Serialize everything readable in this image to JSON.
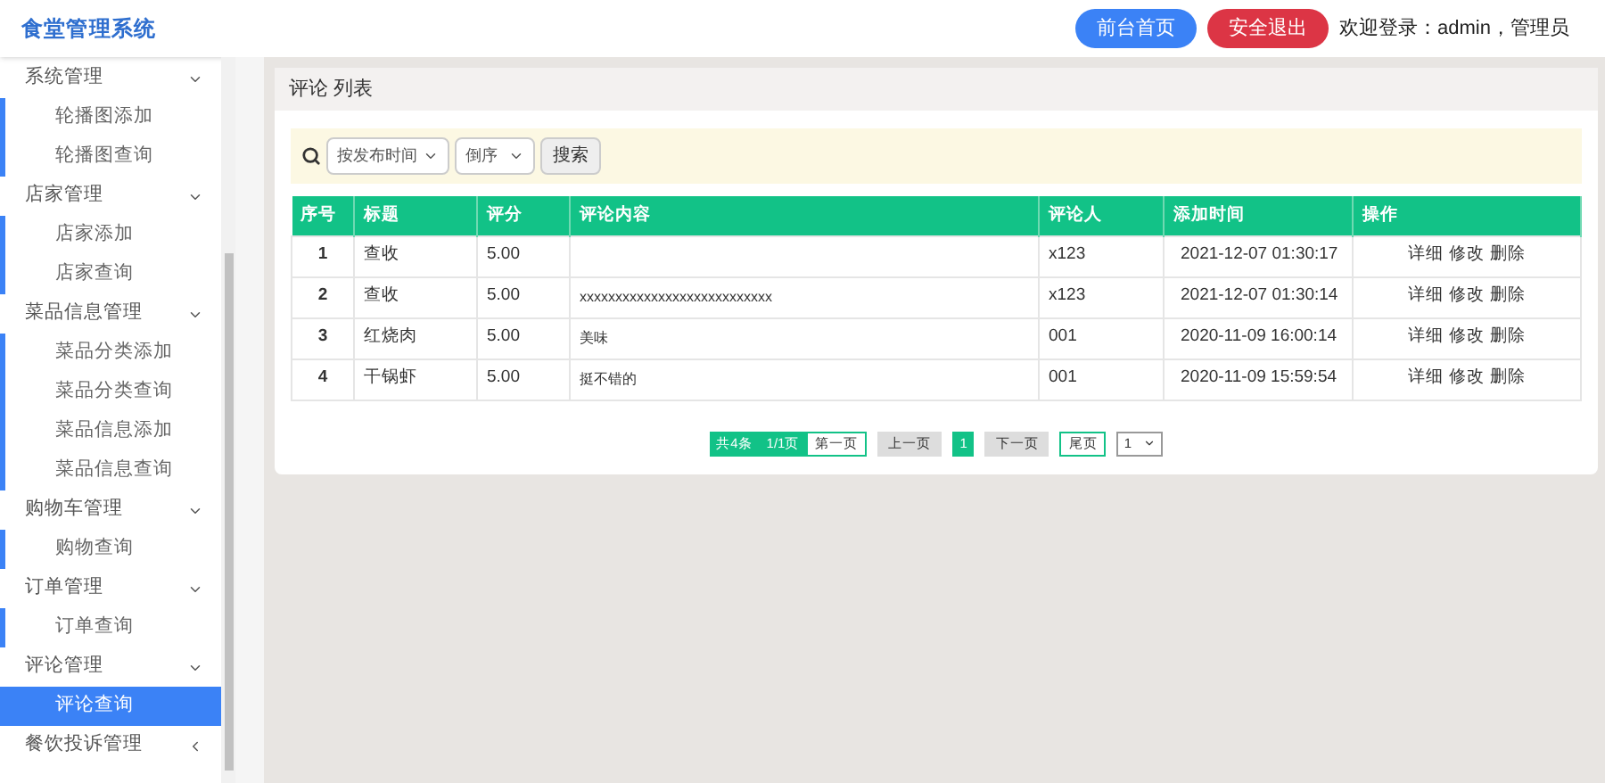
{
  "header": {
    "title": "食堂管理系统",
    "buttons": [
      {
        "label": "前台首页",
        "kind": "primary"
      },
      {
        "label": "安全退出",
        "kind": "danger"
      }
    ],
    "welcome": "欢迎登录：admin，管理员"
  },
  "sidebar": {
    "groups": [
      {
        "label": "系统管理",
        "expanded": true,
        "children": [
          {
            "label": "轮播图添加",
            "selected": false
          },
          {
            "label": "轮播图查询",
            "selected": false
          }
        ]
      },
      {
        "label": "店家管理",
        "expanded": true,
        "children": [
          {
            "label": "店家添加",
            "selected": false
          },
          {
            "label": "店家查询",
            "selected": false
          }
        ]
      },
      {
        "label": "菜品信息管理",
        "expanded": true,
        "children": [
          {
            "label": "菜品分类添加",
            "selected": false
          },
          {
            "label": "菜品分类查询",
            "selected": false
          },
          {
            "label": "菜品信息添加",
            "selected": false
          },
          {
            "label": "菜品信息查询",
            "selected": false
          }
        ]
      },
      {
        "label": "购物车管理",
        "expanded": true,
        "children": [
          {
            "label": "购物查询",
            "selected": false
          }
        ]
      },
      {
        "label": "订单管理",
        "expanded": true,
        "children": [
          {
            "label": "订单查询",
            "selected": false
          }
        ]
      },
      {
        "label": "评论管理",
        "expanded": true,
        "children": [
          {
            "label": "评论查询",
            "selected": true
          }
        ]
      },
      {
        "label": "餐饮投诉管理",
        "expanded": false
      }
    ]
  },
  "panel": {
    "title": "评论 列表",
    "search": {
      "sort_field": "按发布时间",
      "sort_order": "倒序",
      "button": "搜索"
    },
    "table": {
      "columns": [
        "序号",
        "标题",
        "评分",
        "评论内容",
        "评论人",
        "添加时间",
        "操作"
      ],
      "rows": [
        {
          "cells": [
            "1",
            "查收",
            "5.00",
            "",
            "x123",
            "2021-12-07 01:30:17"
          ],
          "actions": [
            "详细",
            "修改",
            "删除"
          ]
        },
        {
          "cells": [
            "2",
            "查收",
            "5.00",
            "xxxxxxxxxxxxxxxxxxxxxxxxxxx",
            "x123",
            "2021-12-07 01:30:14"
          ],
          "actions": [
            "详细",
            "修改",
            "删除"
          ]
        },
        {
          "cells": [
            "3",
            "红烧肉",
            "5.00",
            "美味",
            "001",
            "2020-11-09 16:00:14"
          ],
          "actions": [
            "详细",
            "修改",
            "删除"
          ]
        },
        {
          "cells": [
            "4",
            "干锅虾",
            "5.00",
            "挺不错的",
            "001",
            "2020-11-09 15:59:54"
          ],
          "actions": [
            "详细",
            "修改",
            "删除"
          ]
        }
      ]
    },
    "pagination": {
      "summary": "共4条　1/1页",
      "first": "第一页",
      "prev": "上一页",
      "pages": [
        {
          "label": "1",
          "selected": true
        }
      ],
      "next": "下一页",
      "last": "尾页",
      "page_select": "1"
    }
  }
}
